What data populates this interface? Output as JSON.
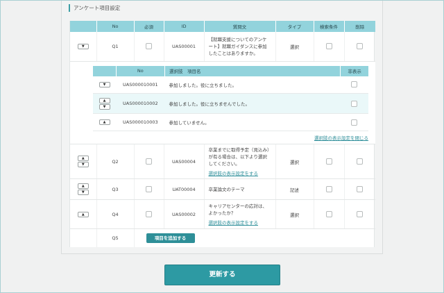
{
  "section_title": "アンケート項目設定",
  "headers": [
    "",
    "No",
    "必須",
    "ID",
    "質問文",
    "タイプ",
    "検索条件",
    "削除"
  ],
  "rows": [
    {
      "no": "Q1",
      "id": "UAS00001",
      "question": "【就職支援についてのアンケート】就職ガイダンスに参加したことはありますか。",
      "type": "選択",
      "link": ""
    },
    {
      "no": "Q2",
      "id": "UAS00004",
      "question": "卒業までに取得予定（見込み）が有る場合は、以下より選択してください。",
      "type": "選択",
      "link": "選択肢の表示設定をする"
    },
    {
      "no": "Q3",
      "id": "UAT00004",
      "question": "卒業論文のテーマ",
      "type": "記述",
      "link": ""
    },
    {
      "no": "Q4",
      "id": "UAS00002",
      "question": "キャリアセンターの応対は、よかったか？",
      "type": "選択",
      "link": "選択肢の表示設定をする"
    }
  ],
  "sub": {
    "headers": [
      "",
      "No",
      "選択肢　項目名",
      "非表示"
    ],
    "rows": [
      {
        "no": "UAS000010001",
        "label": "参加しました。役に立ちました。"
      },
      {
        "no": "UAS000010002",
        "label": "参加しました。役に立ちませんでした。"
      },
      {
        "no": "UAS000010003",
        "label": "参加していません。"
      }
    ],
    "close_link": "選択肢の表示設定を閉じる"
  },
  "next_no": "Q5",
  "add_button": "項目を追加する",
  "update_button": "更新する",
  "arrow_up": "▲",
  "arrow_down": "▼"
}
